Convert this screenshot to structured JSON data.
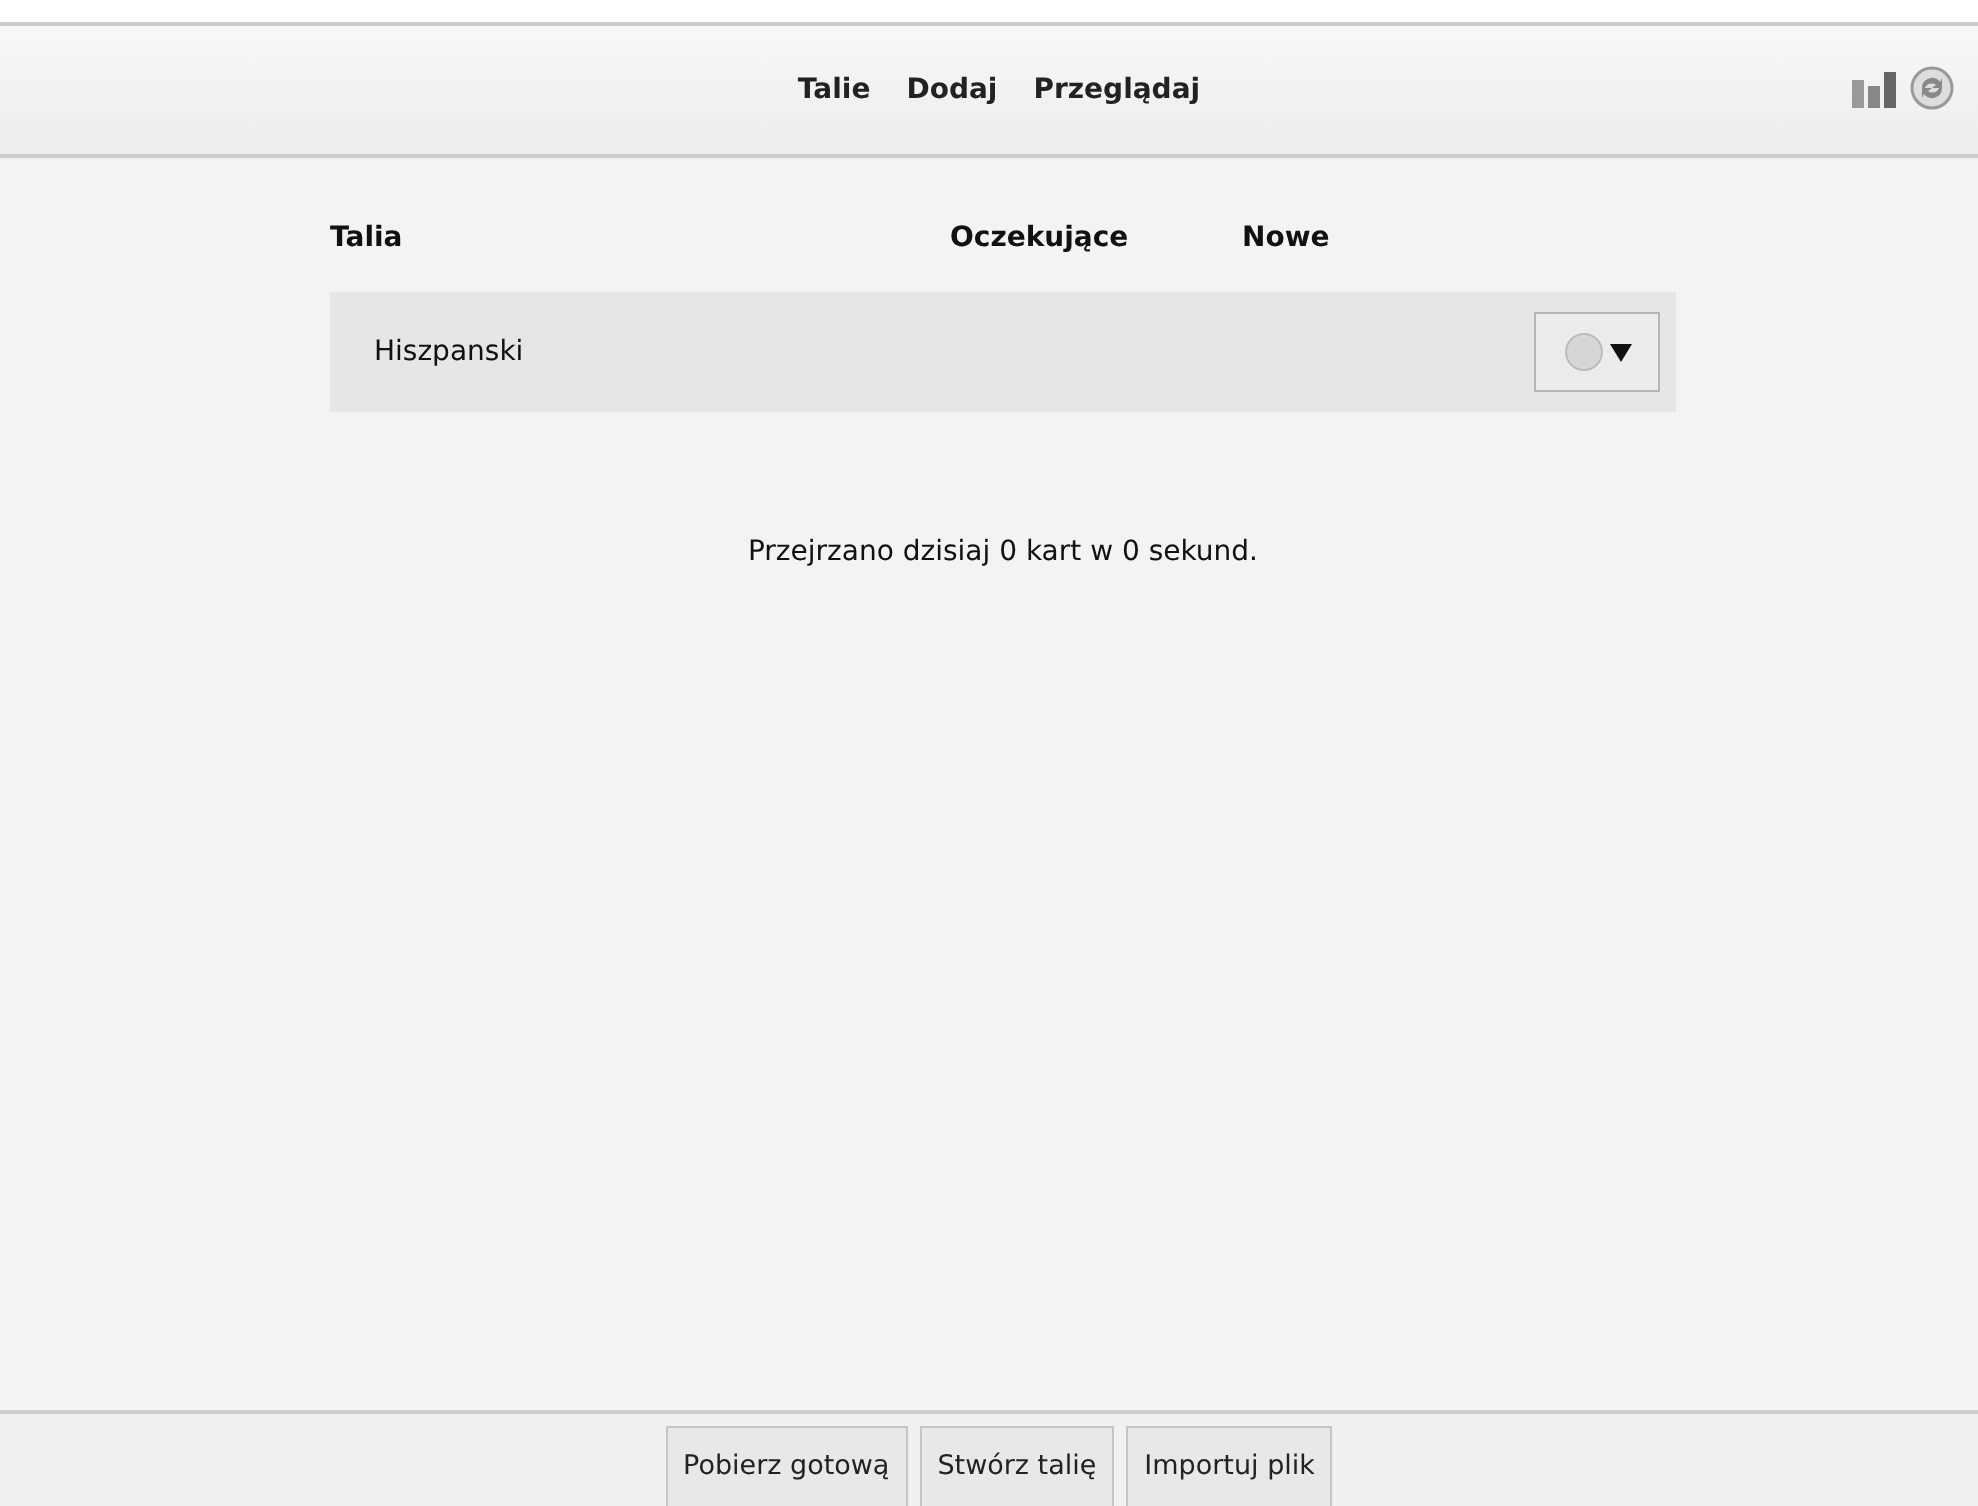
{
  "toolbar": {
    "links": [
      "Talie",
      "Dodaj",
      "Przeglądaj"
    ]
  },
  "deck_table": {
    "columns": [
      "Talia",
      "Oczekujące",
      "Nowe"
    ],
    "rows": [
      {
        "name": "Hiszpanski"
      }
    ]
  },
  "summary": "Przejrzano dzisiaj 0 kart w 0 sekund.",
  "bottom_buttons": [
    "Pobierz gotową",
    "Stwórz talię",
    "Importuj plik"
  ]
}
